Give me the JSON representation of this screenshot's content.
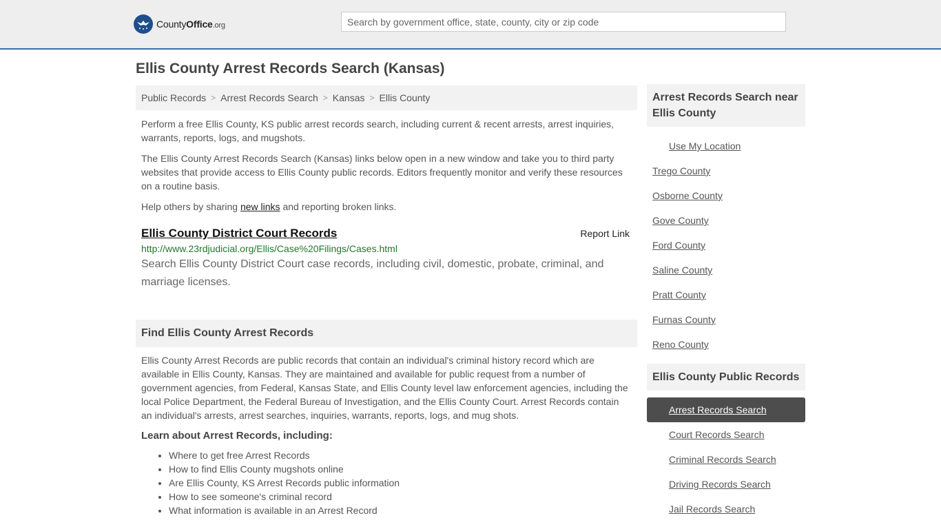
{
  "header": {
    "logo_main": "County",
    "logo_bold": "Office",
    "logo_tld": ".org",
    "search_placeholder": "Search by government office, state, county, city or zip code",
    "accent_color": "#3a6ea5"
  },
  "page_title": "Ellis County Arrest Records Search (Kansas)",
  "breadcrumb": [
    "Public Records",
    "Arrest Records Search",
    "Kansas",
    "Ellis County"
  ],
  "intro": {
    "p1": "Perform a free Ellis County, KS public arrest records search, including current & recent arrests, arrest inquiries, warrants, reports, logs, and mugshots.",
    "p2": "The Ellis County Arrest Records Search (Kansas) links below open in a new window and take you to third party websites that provide access to Ellis County public records. Editors frequently monitor and verify these resources on a routine basis.",
    "p3_before": "Help others by sharing ",
    "p3_link": "new links",
    "p3_after": " and reporting broken links."
  },
  "result": {
    "title": "Ellis County District Court Records",
    "report_label": "Report Link",
    "url": "http://www.23rdjudicial.org/Ellis/Case%20Filings/Cases.html",
    "description": "Search Ellis County District Court case records, including civil, domestic, probate, criminal, and marriage licenses."
  },
  "find_section": {
    "heading": "Find Ellis County Arrest Records",
    "body": "Ellis County Arrest Records are public records that contain an individual's criminal history record which are available in Ellis County, Kansas. They are maintained and available for public request from a number of government agencies, from Federal, Kansas State, and Ellis County level law enforcement agencies, including the local Police Department, the Federal Bureau of Investigation, and the Ellis County Court. Arrest Records contain an individual's arrests, arrest searches, inquiries, warrants, reports, logs, and mug shots.",
    "learn_heading": "Learn about Arrest Records, including:",
    "learn_items": [
      "Where to get free Arrest Records",
      "How to find Ellis County mugshots online",
      "Are Ellis County, KS Arrest Records public information",
      "How to see someone's criminal record",
      "What information is available in an Arrest Record"
    ]
  },
  "sidebar": {
    "near_heading": "Arrest Records Search near Ellis County",
    "use_location": "Use My Location",
    "near_counties": [
      "Trego County",
      "Osborne County",
      "Gove County",
      "Ford County",
      "Saline County",
      "Pratt County",
      "Furnas County",
      "Reno County"
    ],
    "public_heading": "Ellis County Public Records",
    "public_links": [
      "Arrest Records Search",
      "Court Records Search",
      "Criminal Records Search",
      "Driving Records Search",
      "Jail Records Search"
    ]
  }
}
